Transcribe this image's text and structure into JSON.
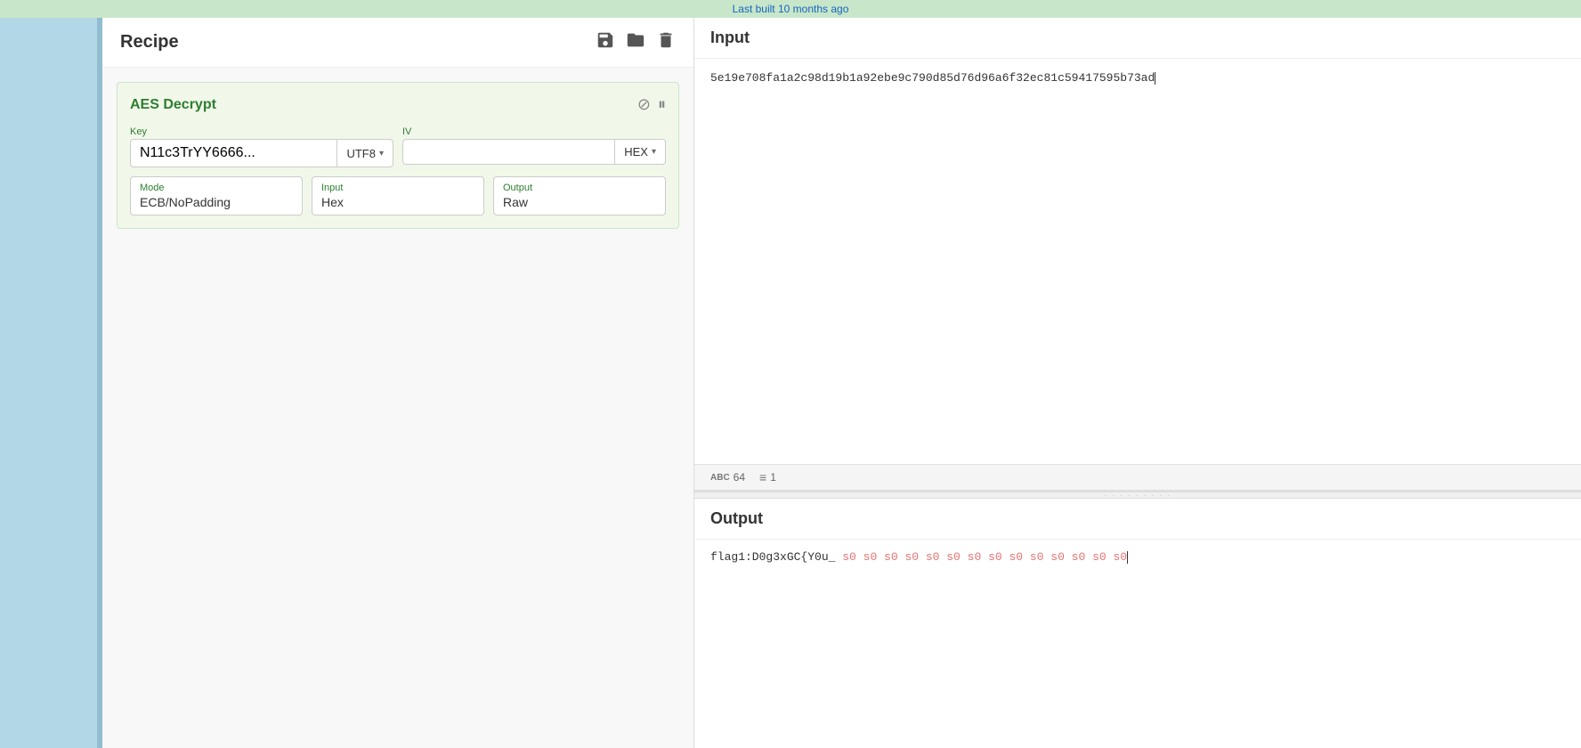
{
  "topbar": {
    "text": "Last built 10 months ago"
  },
  "recipe": {
    "title": "Recipe",
    "save_label": "save",
    "open_label": "open",
    "delete_label": "delete"
  },
  "aes_block": {
    "title": "AES Decrypt",
    "key_label": "Key",
    "key_value": "N11c3TrYY6666...",
    "key_encoding": "UTF8",
    "iv_label": "IV",
    "iv_encoding": "HEX",
    "mode_label": "Mode",
    "mode_value": "ECB/NoPadding",
    "input_label": "Input",
    "input_value": "Hex",
    "output_label": "Output",
    "output_value": "Raw"
  },
  "input_section": {
    "title": "Input",
    "value": "5e19e708fa1a2c98d19b1a92ebe9c790d85d76d96a6f32ec81c59417595b73ad",
    "status": {
      "chars": "64",
      "lines": "1"
    }
  },
  "output_section": {
    "title": "Output",
    "main_text": "flag1:D0g3xGC{Y0u_",
    "padding_text": "s0 s0 s0 s0 s0 s0 s0 s0 s0 s0 s0 s0 s0 s0"
  },
  "icons": {
    "abc": "ABC",
    "lines": "≡",
    "ban": "⊘",
    "pause": "⏸"
  }
}
